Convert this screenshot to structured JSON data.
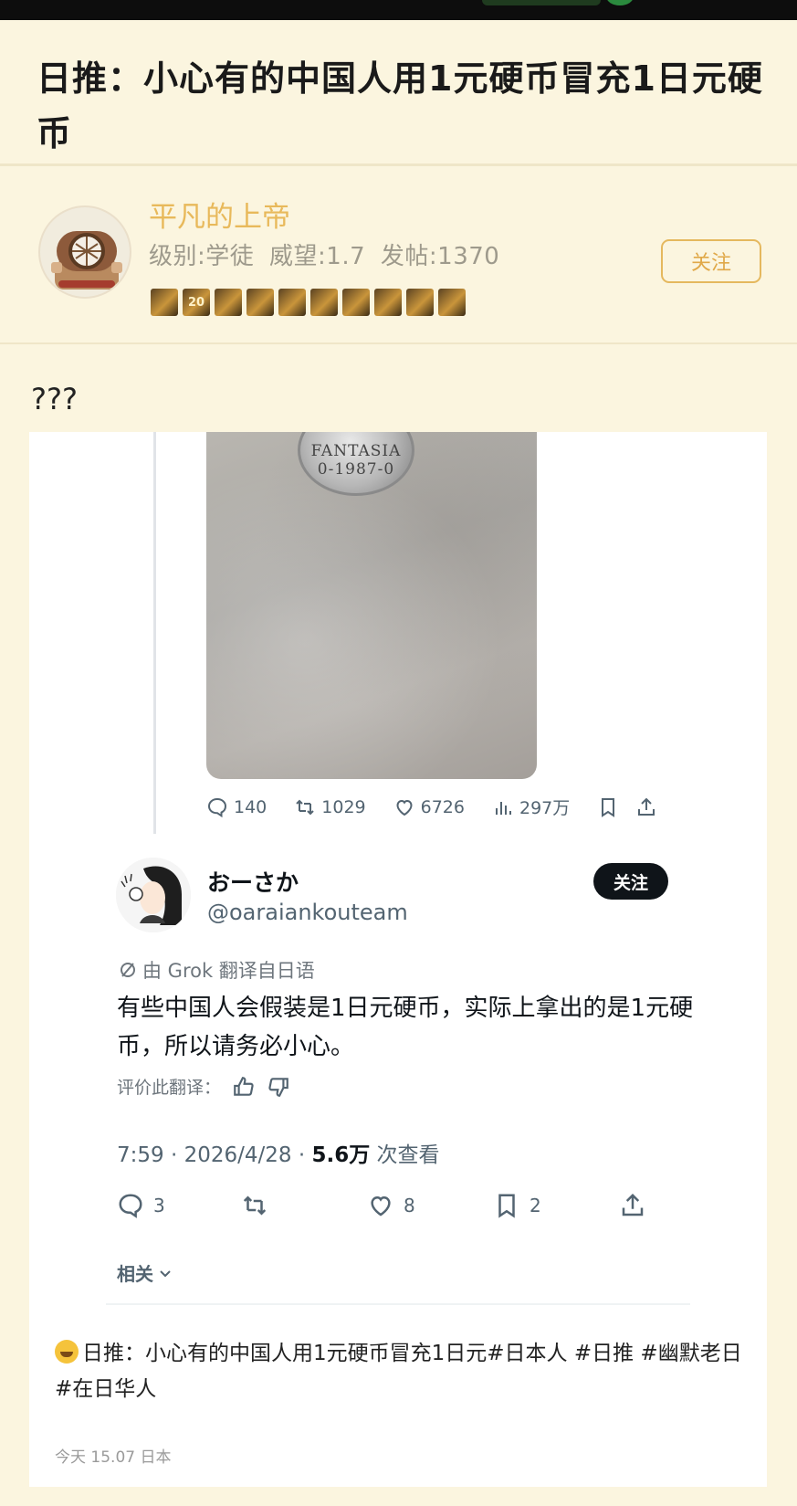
{
  "post": {
    "title": "日推：小心有的中国人用1元硬币冒充1日元硬币",
    "body": "???"
  },
  "author": {
    "name": "平凡的上帝",
    "level": "级别:学徒",
    "prestige": "威望:1.7",
    "posts": "发帖:1370",
    "follow_label": "关注",
    "badges": [
      "",
      "20",
      "",
      "",
      "",
      "",
      "",
      "",
      "",
      ""
    ]
  },
  "screenshot": {
    "coin_text_line1": "FANTASIA",
    "coin_text_line2": "0-1987-0",
    "stats": {
      "replies": "140",
      "retweets": "1029",
      "likes": "6726",
      "views": "297万"
    },
    "tweet": {
      "display_name": "おーさか",
      "handle": "@oaraiankouteam",
      "follow_label": "关注",
      "translated_by": "由 Grok 翻译自日语",
      "text": "有些中国人会假装是1日元硬币，实际上拿出的是1元硬币，所以请务必小心。",
      "rate_label": "评价此翻译：",
      "time": "7:59 · 2026/4/28 · ",
      "views_count": "5.6万",
      "views_label": " 次查看",
      "replies": "3",
      "likes": "8",
      "bookmarks": "2",
      "related_label": "相关"
    },
    "caption_prefix": "日推：",
    "caption_text": "小心有的中国人用1元硬币冒充1日元#日本人 #日推 #幽默老日 #在日华人",
    "timestamp": "今天 15.07 日本"
  }
}
